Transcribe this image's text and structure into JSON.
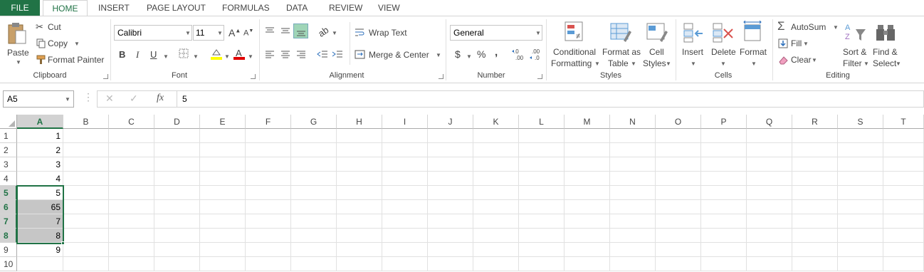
{
  "tabs": [
    "FILE",
    "HOME",
    "INSERT",
    "PAGE LAYOUT",
    "FORMULAS",
    "DATA",
    "REVIEW",
    "VIEW"
  ],
  "clipboard": {
    "paste": "Paste",
    "cut": "Cut",
    "copy": "Copy",
    "format_painter": "Format Painter",
    "label": "Clipboard"
  },
  "font": {
    "name": "Calibri",
    "size": "11",
    "label": "Font",
    "bold": "B",
    "italic": "I",
    "underline": "U"
  },
  "alignment": {
    "wrap": "Wrap Text",
    "merge": "Merge & Center",
    "label": "Alignment"
  },
  "number": {
    "format": "General",
    "label": "Number",
    "currency": "$",
    "percent": "%",
    "comma": ","
  },
  "styles": {
    "conditional": "Conditional",
    "conditional2": "Formatting",
    "format_as": "Format as",
    "format_as2": "Table",
    "cell": "Cell",
    "cell2": "Styles",
    "label": "Styles"
  },
  "cells": {
    "insert": "Insert",
    "delete": "Delete",
    "format": "Format",
    "label": "Cells"
  },
  "editing": {
    "autosum": "AutoSum",
    "fill": "Fill",
    "clear": "Clear",
    "sort": "Sort &",
    "sort2": "Filter",
    "find": "Find &",
    "find2": "Select",
    "label": "Editing"
  },
  "formula_bar": {
    "name_box": "A5",
    "formula": "5",
    "fx": "fx"
  },
  "columns": [
    "A",
    "B",
    "C",
    "D",
    "E",
    "F",
    "G",
    "H",
    "I",
    "J",
    "K",
    "L",
    "M",
    "N",
    "O",
    "P",
    "Q",
    "R",
    "S",
    "T"
  ],
  "rows": [
    "1",
    "2",
    "3",
    "4",
    "5",
    "6",
    "7",
    "8",
    "9",
    "10"
  ],
  "column_a_values": [
    "1",
    "2",
    "3",
    "4",
    "5",
    "65",
    "7",
    "8",
    "9",
    ""
  ],
  "colors": {
    "accent": "#217346",
    "selection_fill": "#c6c6c6",
    "header_active": "#d2d2d2"
  }
}
